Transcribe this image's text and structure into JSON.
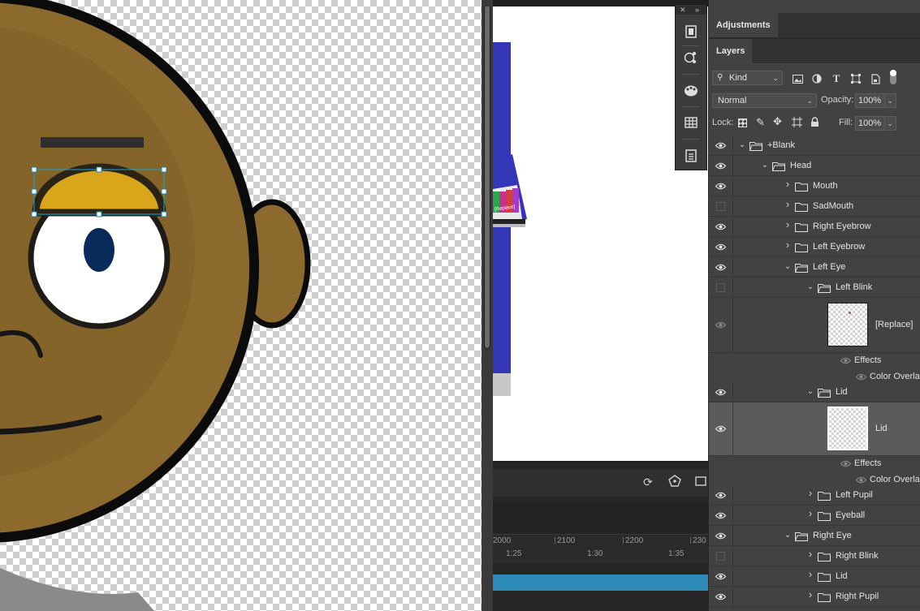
{
  "panels": {
    "adjustments_tab": "Adjustments",
    "layers_tab": "Layers"
  },
  "filter": {
    "kind_label": "Kind",
    "icons": [
      "image-filter-icon",
      "adjustment-filter-icon",
      "type-filter-icon",
      "shape-filter-icon",
      "smart-object-filter-icon"
    ]
  },
  "blend": {
    "mode": "Normal",
    "opacity_label": "Opacity:",
    "opacity_value": "100%",
    "lock_label": "Lock:",
    "fill_label": "Fill:",
    "fill_value": "100%"
  },
  "layers": [
    {
      "name": "+Blank",
      "visible": true,
      "expanded": true,
      "type": "group"
    },
    {
      "name": "Head",
      "visible": true,
      "expanded": true,
      "type": "group"
    },
    {
      "name": "Mouth",
      "visible": true,
      "expanded": false,
      "type": "group"
    },
    {
      "name": "SadMouth",
      "visible": false,
      "expanded": false,
      "type": "group"
    },
    {
      "name": "Right Eyebrow",
      "visible": true,
      "expanded": false,
      "type": "group"
    },
    {
      "name": "Left Eyebrow",
      "visible": true,
      "expanded": false,
      "type": "group"
    },
    {
      "name": "Left Eye",
      "visible": true,
      "expanded": true,
      "type": "group"
    },
    {
      "name": "Left Blink",
      "visible": false,
      "expanded": true,
      "type": "group"
    },
    {
      "name": "[Replace]",
      "visible": true,
      "type": "layer"
    },
    {
      "name": "Effects",
      "type": "effects"
    },
    {
      "name": "Color Overlay",
      "type": "effect"
    },
    {
      "name": "Lid",
      "visible": true,
      "expanded": true,
      "type": "group"
    },
    {
      "name": "Lid",
      "visible": true,
      "type": "layer",
      "selected": true
    },
    {
      "name": "Effects",
      "type": "effects"
    },
    {
      "name": "Color Overlay",
      "type": "effect"
    },
    {
      "name": "Left Pupil",
      "visible": true,
      "expanded": false,
      "type": "group"
    },
    {
      "name": "Eyeball",
      "visible": true,
      "expanded": false,
      "type": "group"
    },
    {
      "name": "Right Eye",
      "visible": true,
      "expanded": true,
      "type": "group"
    },
    {
      "name": "Right Blink",
      "visible": false,
      "expanded": false,
      "type": "group"
    },
    {
      "name": "Lid",
      "visible": true,
      "expanded": false,
      "type": "group"
    },
    {
      "name": "Right Pupil",
      "visible": true,
      "expanded": false,
      "type": "group"
    }
  ],
  "timeline": {
    "frame_labels": [
      "2000",
      "2100",
      "2200",
      "230"
    ],
    "time_labels": [
      "1:25",
      "1:30",
      "1:35"
    ]
  },
  "document": {
    "replace_label": "[Replace]"
  },
  "colors": {
    "skin": "#8c6a2e",
    "skin_shadow": "#7c5e26",
    "lid": "#d9a51a",
    "pupil": "#082b5c",
    "outline": "#0b0b0b",
    "selection": "#1aa6d6",
    "timeline_bar": "#2d8ab8"
  }
}
